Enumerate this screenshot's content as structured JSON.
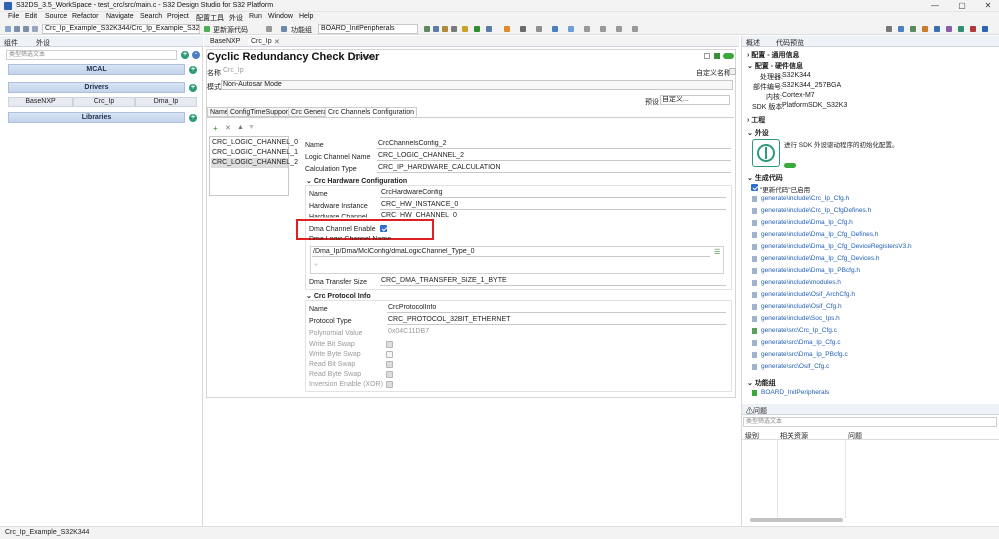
{
  "window": {
    "title": "S32DS_3.5_WorkSpace - test_crc/src/main.c - S32 Design Studio for S32 Platform",
    "min": "—",
    "max": "▢",
    "close": "✕"
  },
  "menu": [
    "File",
    "Edit",
    "Source",
    "Refactor",
    "Navigate",
    "Search",
    "Project",
    "配置工具",
    "外设",
    "Run",
    "Window",
    "Help"
  ],
  "toolbar": {
    "project_combo": "Crc_Ip_Example_S32K344/Crc_Ip_Example_S32K",
    "update_code": "更新源代码",
    "func_group_label": "功能组",
    "func_group_value": "BOARD_InitPeripherals"
  },
  "left": {
    "tabs": [
      "组件",
      "外设"
    ],
    "filter_placeholder": "类型筛选文本",
    "sections": {
      "mcal": "MCAL",
      "drivers": "Drivers",
      "libraries": "Libraries"
    },
    "drivers": [
      "BaseNXP",
      "Crc_Ip",
      "Dma_Ip"
    ]
  },
  "editor": {
    "tabs": [
      "BaseNXP",
      "Crc_Ip"
    ],
    "title": "Cyclic Redundancy Check Driver",
    "title_suffix": "(Drivers)",
    "name_label": "名称",
    "name_value": "Crc_Ip",
    "custom_name_label": "自定义名称",
    "mode_label": "模式",
    "mode_value": "Non-Autosar Mode",
    "preset_label": "预设",
    "preset_value": "自定义...",
    "config_tabs": [
      "Name",
      "ConfigTimeSupport",
      "Crc General",
      "Crc Channels Configuration"
    ],
    "toolbar_icons": [
      "+",
      "✕",
      "▲",
      "▼"
    ],
    "channels": [
      "CRC_LOGIC_CHANNEL_0",
      "CRC_LOGIC_CHANNEL_1",
      "CRC_LOGIC_CHANNEL_2"
    ],
    "fields": {
      "name_l": "Name",
      "name_v": "CrcChannelsConfig_2",
      "lcn_l": "Logic Channel Name",
      "lcn_v": "CRC_LOGIC_CHANNEL_2",
      "ct_l": "Calculation Type",
      "ct_v": "CRC_IP_HARDWARE_CALCULATION"
    },
    "hw": {
      "header": "Crc Hardware Configuration",
      "name_l": "Name",
      "name_v": "CrcHardwareConfig",
      "hi_l": "Hardware Instance",
      "hi_v": "CRC_HW_INSTANCE_0",
      "hc_l": "Hardware Channel",
      "hc_v": "CRC_HW_CHANNEL_0",
      "dma_l": "Dma Channel Enable",
      "dmaln_l": "Dma Logic Channel Name",
      "dmaln_v": "/Dma_Ip/Dma/MclConfig/dmaLogicChannel_Type_0",
      "dts_l": "Dma Transfer Size",
      "dts_v": "CRC_DMA_TRANSFER_SIZE_1_BYTE"
    },
    "proto": {
      "header": "Crc Protocol Info",
      "name_l": "Name",
      "name_v": "CrcProtocolInfo",
      "pt_l": "Protocol Type",
      "pt_v": "CRC_PROTOCOL_32BIT_ETHERNET",
      "poly_l": "Polynomial Value",
      "poly_v": "0x04C11DB7",
      "wbs": "Write Bit Swap",
      "wbys": "Write Byte Swap",
      "rbs": "Read Bit Swap",
      "rbys": "Read Byte Swap",
      "inv": "Inversion Enable (XOR)"
    }
  },
  "right": {
    "tabs": [
      "概述",
      "代码预览"
    ],
    "g1": "配置 - 通用信息",
    "g2": "配置 - 硬件信息",
    "processor_l": "处理器:",
    "processor_v": "S32K344",
    "part_l": "部件编号:",
    "part_v": "S32K344_257BGA",
    "core_l": "内核:",
    "core_v": "Cortex-M7",
    "sdk_l": "SDK 版本:",
    "sdk_v": "PlatformSDK_S32K3",
    "project": "工程",
    "periph": "外设",
    "periph_desc": "进行 SDK 外设驱动程序的初始化配置。",
    "gencode": "生成代码",
    "gen_enabled": "\"更新代码\"已启用",
    "files": [
      "generate\\include\\Crc_Ip_Cfg.h",
      "generate\\include\\Crc_Ip_CfgDefines.h",
      "generate\\include\\Dma_Ip_Cfg.h",
      "generate\\include\\Dma_Ip_Cfg_Defines.h",
      "generate\\include\\Dma_Ip_Cfg_DeviceRegistersV3.h",
      "generate\\include\\Dma_Ip_Cfg_Devices.h",
      "generate\\include\\Dma_Ip_PBcfg.h",
      "generate\\include\\modules.h",
      "generate\\include\\Osif_ArchCfg.h",
      "generate\\include\\Osif_Cfg.h",
      "generate\\include\\Soc_Ips.h",
      "generate\\src\\Crc_Ip_Cfg.c",
      "generate\\src\\Dma_Ip_Cfg.c",
      "generate\\src\\Dma_Ip_PBcfg.c",
      "generate\\src\\Osif_Cfg.c"
    ],
    "funcgroup": "功能组",
    "funcgroup_item": "BOARD_InitPeripherals"
  },
  "problems": {
    "tab": "问题",
    "filter_placeholder": "类型筛选文本",
    "cols": [
      "级别",
      "相关资源",
      "问题"
    ]
  },
  "status": {
    "text": "Crc_Ip_Example_S32K344"
  },
  "highlight_color": "#e02020"
}
